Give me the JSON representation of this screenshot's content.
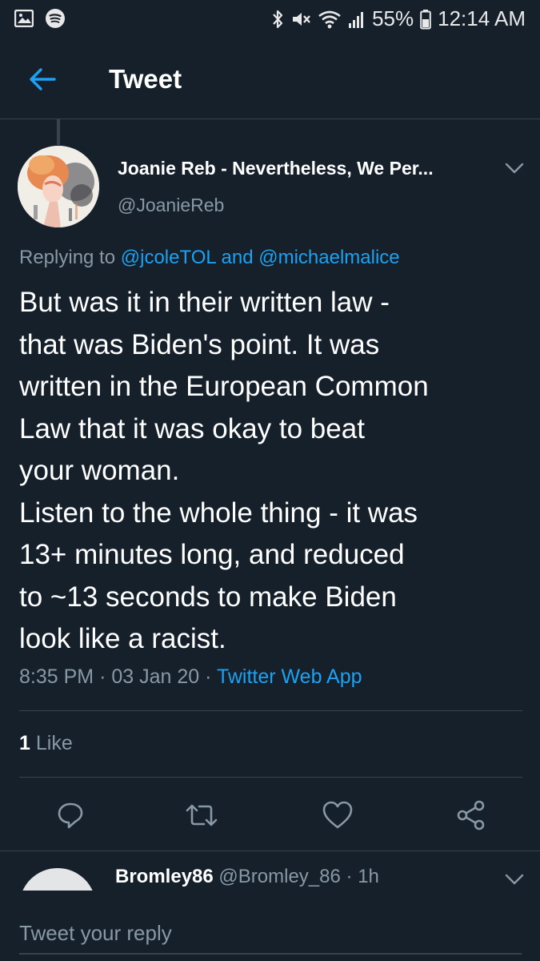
{
  "status_bar": {
    "battery": "55%",
    "time": "12:14 AM"
  },
  "header": {
    "title": "Tweet"
  },
  "tweet": {
    "author_name": "Joanie Reb - Nevertheless, We Per...",
    "author_handle": "@JoanieReb",
    "replying_prefix": "Replying to",
    "replying_to": [
      "@jcoleTOL",
      "@michaelmalice"
    ],
    "replying_joiner": "and",
    "text": "But was it in their written law -\nthat was Biden's point.  It was\nwritten in the European Common\nLaw that it was okay to beat\nyour woman.\nListen to the whole thing - it was\n13+ minutes long, and reduced\nto ~13 seconds to make Biden\nlook like a racist.",
    "time": "8:35 PM",
    "date": "03 Jan 20",
    "separator": "·",
    "source": "Twitter Web App",
    "like_count": "1",
    "like_label": "Like"
  },
  "reply_preview": {
    "name": "Bromley86",
    "handle": "@Bromley_86",
    "age": "1h"
  },
  "composer": {
    "placeholder": "Tweet your reply"
  },
  "colors": {
    "background": "#15202b",
    "accent": "#1da1f2",
    "secondary_text": "#8899a6",
    "divider": "#38444d"
  },
  "icons": [
    "back-arrow-icon",
    "reply-icon",
    "retweet-icon",
    "like-icon",
    "share-icon",
    "chevron-down-icon"
  ]
}
